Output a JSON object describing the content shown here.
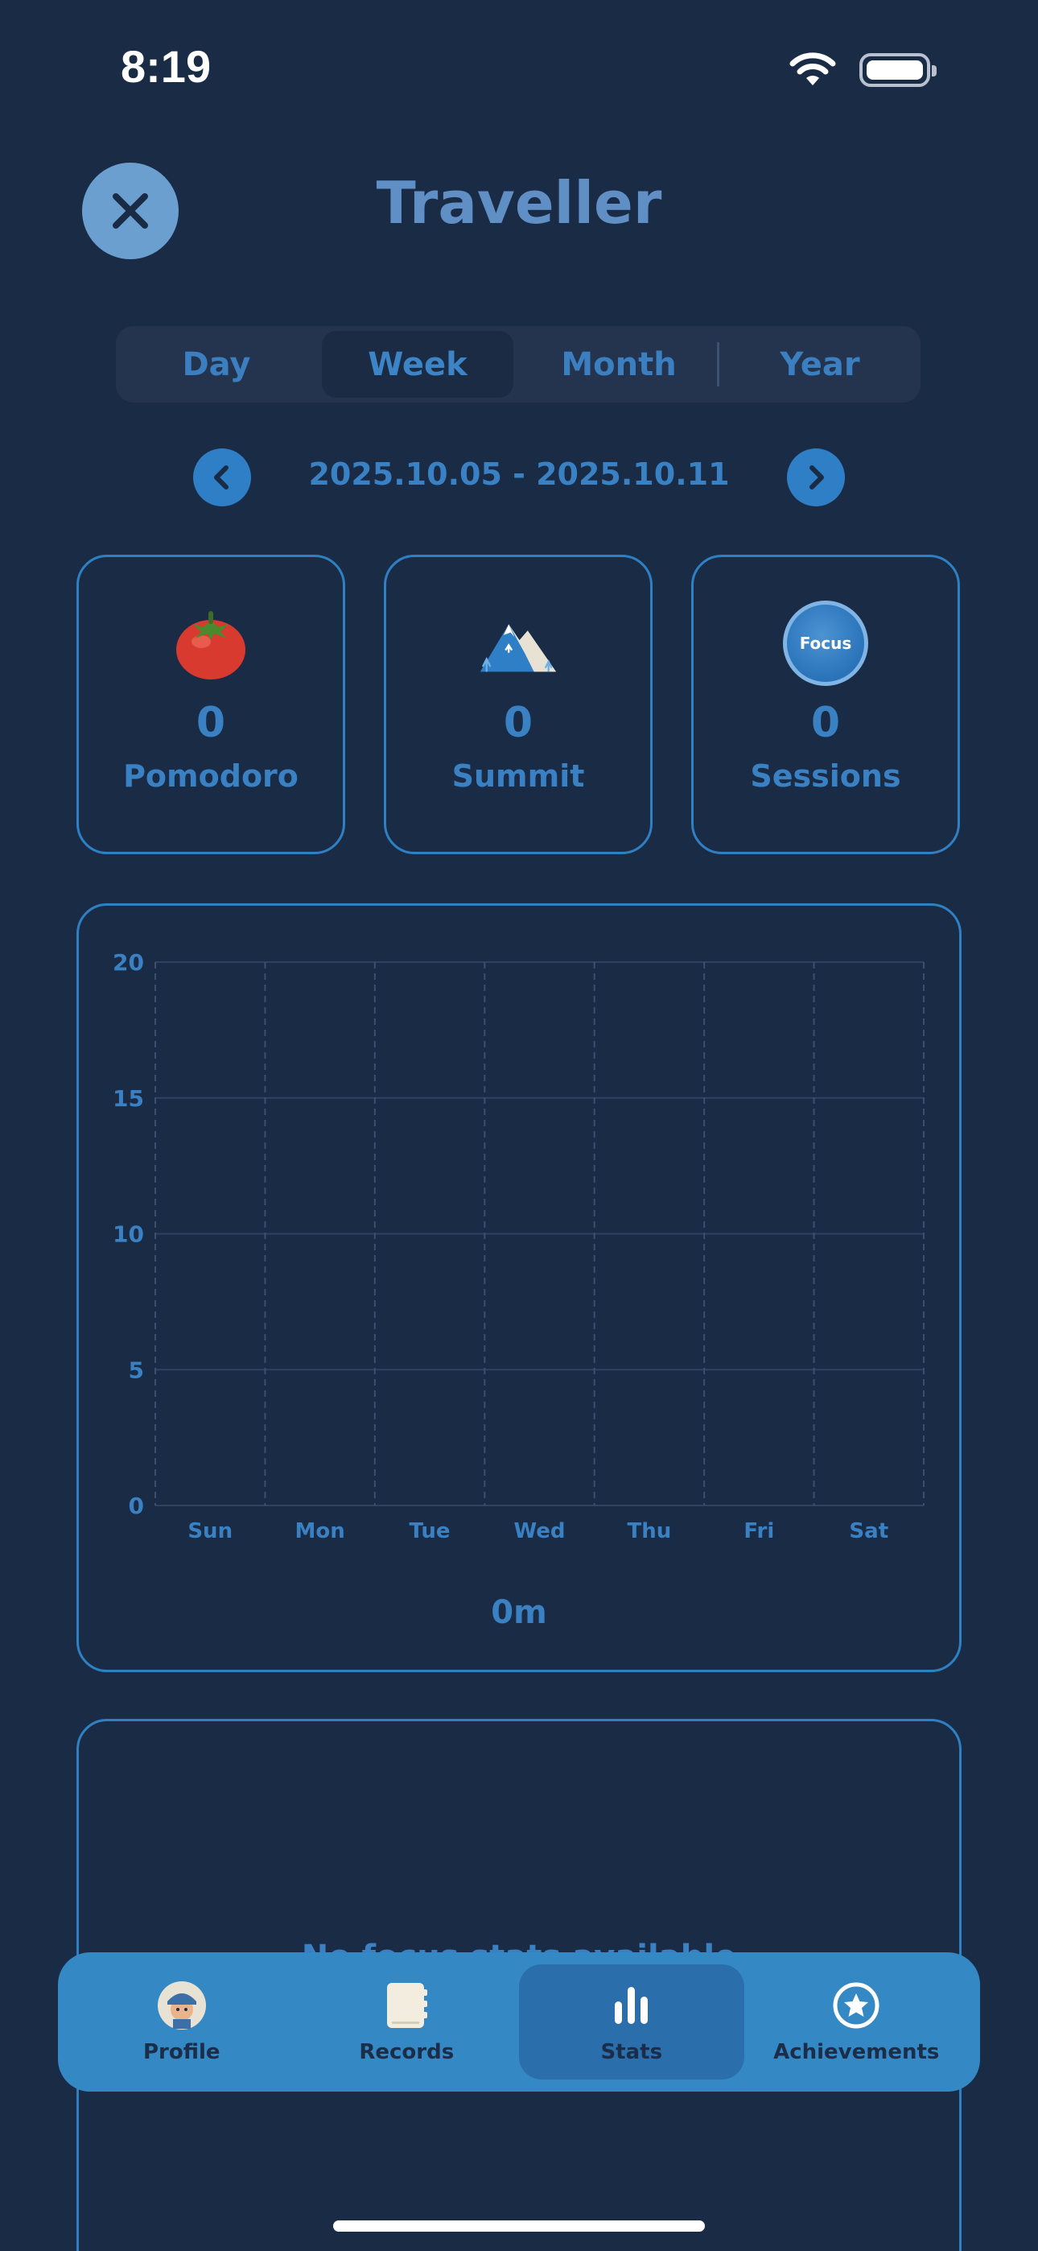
{
  "status_bar": {
    "time": "8:19"
  },
  "header": {
    "title": "Traveller"
  },
  "period_tabs": [
    {
      "label": "Day",
      "active": false
    },
    {
      "label": "Week",
      "active": true
    },
    {
      "label": "Month",
      "active": false
    },
    {
      "label": "Year",
      "active": false
    }
  ],
  "date_range": "2025.10.05 - 2025.10.11",
  "stats": [
    {
      "value": "0",
      "label": "Pomodoro",
      "icon": "tomato-icon"
    },
    {
      "value": "0",
      "label": "Summit",
      "icon": "mountain-icon"
    },
    {
      "value": "0",
      "label": "Sessions",
      "icon": "focus-badge-icon",
      "badge_text": "Focus"
    }
  ],
  "chart_data": {
    "type": "bar",
    "categories": [
      "Sun",
      "Mon",
      "Tue",
      "Wed",
      "Thu",
      "Fri",
      "Sat"
    ],
    "values": [
      0,
      0,
      0,
      0,
      0,
      0,
      0
    ],
    "ylim": [
      0,
      20
    ],
    "yticks": [
      0,
      5,
      10,
      15,
      20
    ],
    "grid": true,
    "total_label": "0m"
  },
  "extra_card": {
    "text": "No focus stats available"
  },
  "tab_bar": [
    {
      "label": "Profile",
      "icon": "avatar-icon",
      "active": false
    },
    {
      "label": "Records",
      "icon": "notebook-icon",
      "active": false
    },
    {
      "label": "Stats",
      "icon": "bar-chart-icon",
      "active": true
    },
    {
      "label": "Achievements",
      "icon": "star-badge-icon",
      "active": false
    }
  ],
  "colors": {
    "background": "#1a2b46",
    "accent": "#3a81c4",
    "tab_bar": "#3488c4"
  }
}
